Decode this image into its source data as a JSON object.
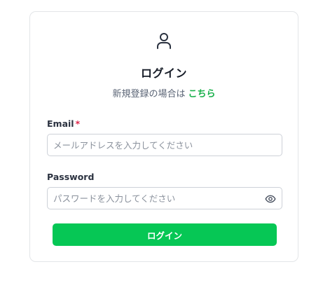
{
  "header": {
    "icon": "user-icon",
    "title": "ログイン",
    "subtitle": "新規登録の場合は",
    "signup_link": "こちら"
  },
  "form": {
    "email": {
      "label": "Email",
      "required_mark": "*",
      "placeholder": "メールアドレスを入力してください",
      "value": ""
    },
    "password": {
      "label": "Password",
      "placeholder": "パスワードを入力してください",
      "value": "",
      "toggle_icon": "eye-icon"
    },
    "submit_label": "ログイン"
  },
  "colors": {
    "accent": "#06c755",
    "link": "#18b04a",
    "required": "#e0264b"
  }
}
